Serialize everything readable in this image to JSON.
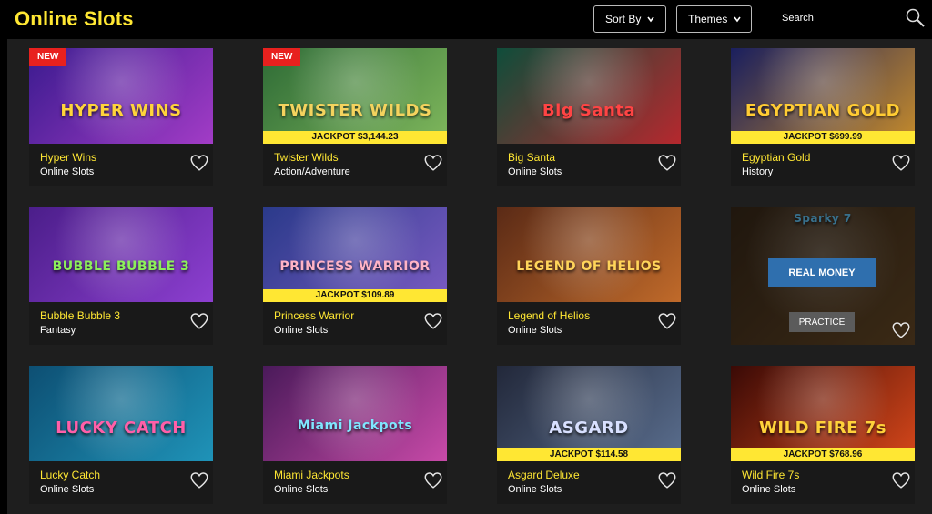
{
  "header": {
    "title": "Online Slots",
    "sort_label": "Sort By",
    "themes_label": "Themes",
    "search_label": "Search"
  },
  "games": [
    {
      "name": "Hyper Wins",
      "category": "Online Slots",
      "badge": "NEW",
      "jackpot": "",
      "logo": "HYPER WINS",
      "colors": [
        "#3b1b8f",
        "#a23cc6"
      ],
      "logo_color": "#ffd43b"
    },
    {
      "name": "Twister Wilds",
      "category": "Action/Adventure",
      "badge": "NEW",
      "jackpot": "JACKPOT $3,144.23",
      "logo": "TWISTER WILDS",
      "colors": [
        "#2e6b36",
        "#7fb75c"
      ],
      "logo_color": "#f4d35e"
    },
    {
      "name": "Big Santa",
      "category": "Online Slots",
      "badge": "",
      "jackpot": "",
      "logo": "Big Santa",
      "colors": [
        "#0f4d3a",
        "#b5282e"
      ],
      "logo_color": "#ff4444"
    },
    {
      "name": "Egyptian Gold",
      "category": "History",
      "badge": "",
      "jackpot": "JACKPOT $699.99",
      "logo": "EGYPTIAN GOLD",
      "colors": [
        "#1a1f5e",
        "#c58b2b"
      ],
      "logo_color": "#ffcc33"
    },
    {
      "name": "Bubble Bubble 3",
      "category": "Fantasy",
      "badge": "",
      "jackpot": "",
      "logo": "BUBBLE BUBBLE 3",
      "colors": [
        "#4b1e8a",
        "#8d3fd0"
      ],
      "logo_color": "#8cf05a"
    },
    {
      "name": "Princess Warrior",
      "category": "Online Slots",
      "badge": "",
      "jackpot": "JACKPOT $109.89",
      "logo": "PRINCESS WARRIOR",
      "colors": [
        "#2a3a8a",
        "#7a5bc2"
      ],
      "logo_color": "#ffb3c6"
    },
    {
      "name": "Legend of Helios",
      "category": "Online Slots",
      "badge": "",
      "jackpot": "",
      "logo": "LEGEND OF HELIOS",
      "colors": [
        "#5a2a16",
        "#c06a2a"
      ],
      "logo_color": "#ffd45a"
    },
    {
      "name": "",
      "category": "",
      "badge": "",
      "jackpot": "",
      "logo": "Sparky 7",
      "colors": [
        "#3a2a1a",
        "#6b4c28"
      ],
      "logo_color": "#66ccff",
      "hover": true,
      "real_money": "REAL MONEY",
      "practice": "PRACTICE"
    },
    {
      "name": "Lucky Catch",
      "category": "Online Slots",
      "badge": "",
      "jackpot": "",
      "logo": "LUCKY CATCH",
      "colors": [
        "#0d4f73",
        "#1f93b8"
      ],
      "logo_color": "#ff5fa8"
    },
    {
      "name": "Miami Jackpots",
      "category": "Online Slots",
      "badge": "",
      "jackpot": "",
      "logo": "Miami Jackpots",
      "colors": [
        "#4a1a5a",
        "#c84aa8"
      ],
      "logo_color": "#7fe7ff"
    },
    {
      "name": "Asgard Deluxe",
      "category": "Online Slots",
      "badge": "",
      "jackpot": "JACKPOT $114.58",
      "logo": "ASGARD",
      "colors": [
        "#22283a",
        "#5a6e8e"
      ],
      "logo_color": "#d8e0ff"
    },
    {
      "name": "Wild Fire 7s",
      "category": "Online Slots",
      "badge": "",
      "jackpot": "JACKPOT $768.96",
      "logo": "WILD FIRE 7s",
      "colors": [
        "#3a0a06",
        "#d6471a"
      ],
      "logo_color": "#ffd23a"
    }
  ],
  "icons": {
    "heart": "heart-icon",
    "search": "search-icon",
    "chevron": "chevron-down-icon"
  }
}
